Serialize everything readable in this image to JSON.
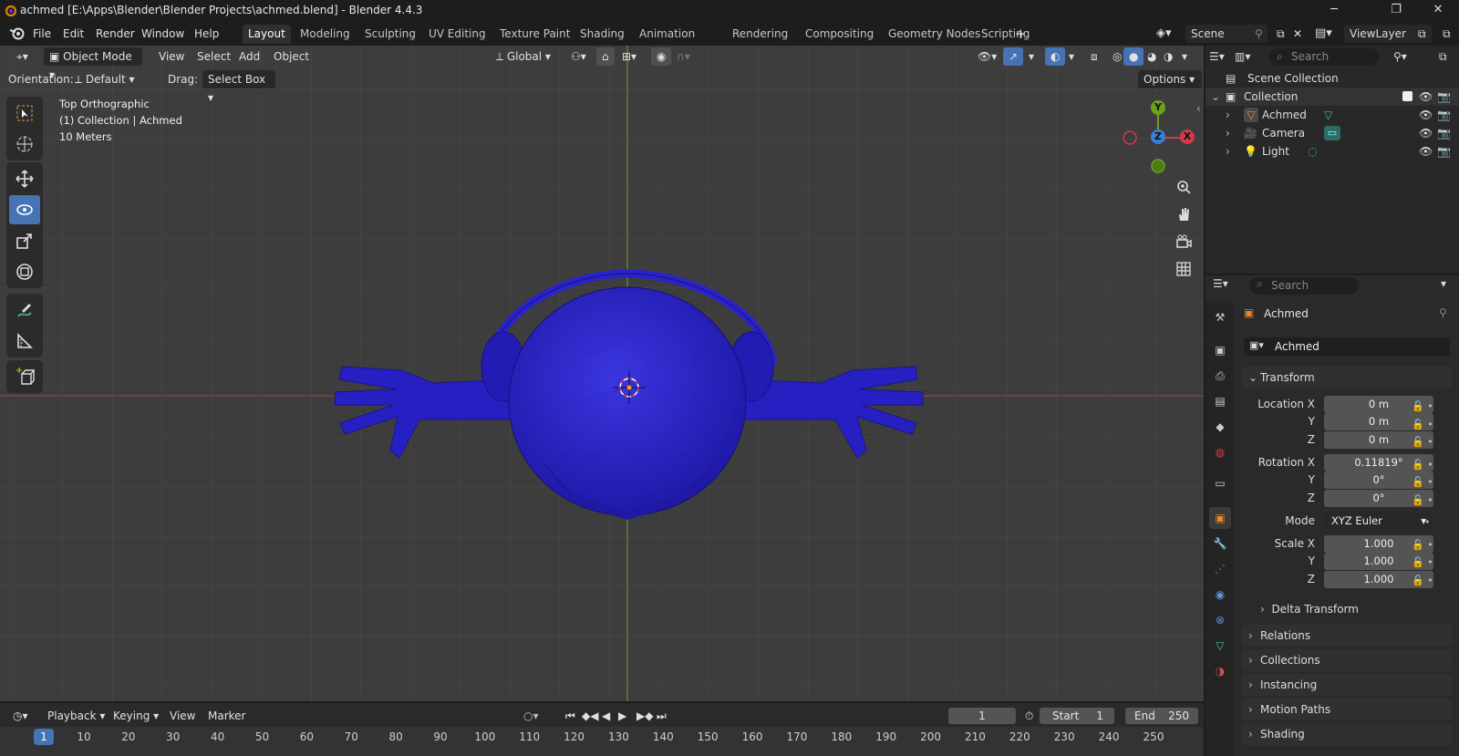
{
  "window": {
    "title": "achmed [E:\\Apps\\Blender\\Blender Projects\\achmed.blend] - Blender 4.4.3"
  },
  "menu": {
    "file": "File",
    "edit": "Edit",
    "render": "Render",
    "window": "Window",
    "help": "Help"
  },
  "workspaces": [
    "Layout",
    "Modeling",
    "Sculpting",
    "UV Editing",
    "Texture Paint",
    "Shading",
    "Animation",
    "Rendering",
    "Compositing",
    "Geometry Nodes",
    "Scripting"
  ],
  "scene": {
    "name": "Scene",
    "view_layer": "ViewLayer"
  },
  "viewport_header": {
    "mode": "Object Mode",
    "view": "View",
    "select": "Select",
    "add": "Add",
    "object": "Object",
    "transform_orientation": "Global"
  },
  "tool_settings": {
    "orientation_label": "Orientation:",
    "orientation_value": "Default",
    "drag_label": "Drag:",
    "drag_value": "Select Box",
    "options": "Options"
  },
  "viewport_info": {
    "view_name": "Top Orthographic",
    "collection": "(1) Collection | Achmed",
    "scale": "10 Meters"
  },
  "gizmo": {
    "y": "Y",
    "z": "Z",
    "x": "X"
  },
  "outliner": {
    "search_placeholder": "Search",
    "scene_collection": "Scene Collection",
    "collection": "Collection",
    "items": [
      "Achmed",
      "Camera",
      "Light"
    ]
  },
  "properties": {
    "search_placeholder": "Search",
    "object_name": "Achmed",
    "object_field": "Achmed",
    "transform_title": "Transform",
    "location": {
      "label": "Location X",
      "x": "0 m",
      "y": "0 m",
      "z": "0 m"
    },
    "rotation": {
      "label": "Rotation X",
      "x": "0.11819°",
      "y": "0°",
      "z": "0°"
    },
    "mode_label": "Mode",
    "mode_value": "XYZ Euler",
    "scale": {
      "label": "Scale X",
      "x": "1.000",
      "y": "1.000",
      "z": "1.000"
    },
    "axis_y": "Y",
    "axis_z": "Z",
    "delta_transform": "Delta Transform",
    "panels": [
      "Relations",
      "Collections",
      "Instancing",
      "Motion Paths",
      "Shading"
    ]
  },
  "timeline": {
    "playback": "Playback",
    "keying": "Keying",
    "view": "View",
    "marker": "Marker",
    "current_frame": "1",
    "start_label": "Start",
    "start_value": "1",
    "end_label": "End",
    "end_value": "250",
    "ticks": [
      "1",
      "10",
      "20",
      "30",
      "40",
      "50",
      "60",
      "70",
      "80",
      "90",
      "100",
      "110",
      "120",
      "130",
      "140",
      "150",
      "160",
      "170",
      "180",
      "190",
      "200",
      "210",
      "220",
      "230",
      "240",
      "250"
    ]
  },
  "colors": {
    "accent": "#4772b3",
    "x_axis": "#d03a4c",
    "y_axis": "#6aa21d",
    "z_axis": "#3a7fd6",
    "mesh": "#2a22c8"
  }
}
